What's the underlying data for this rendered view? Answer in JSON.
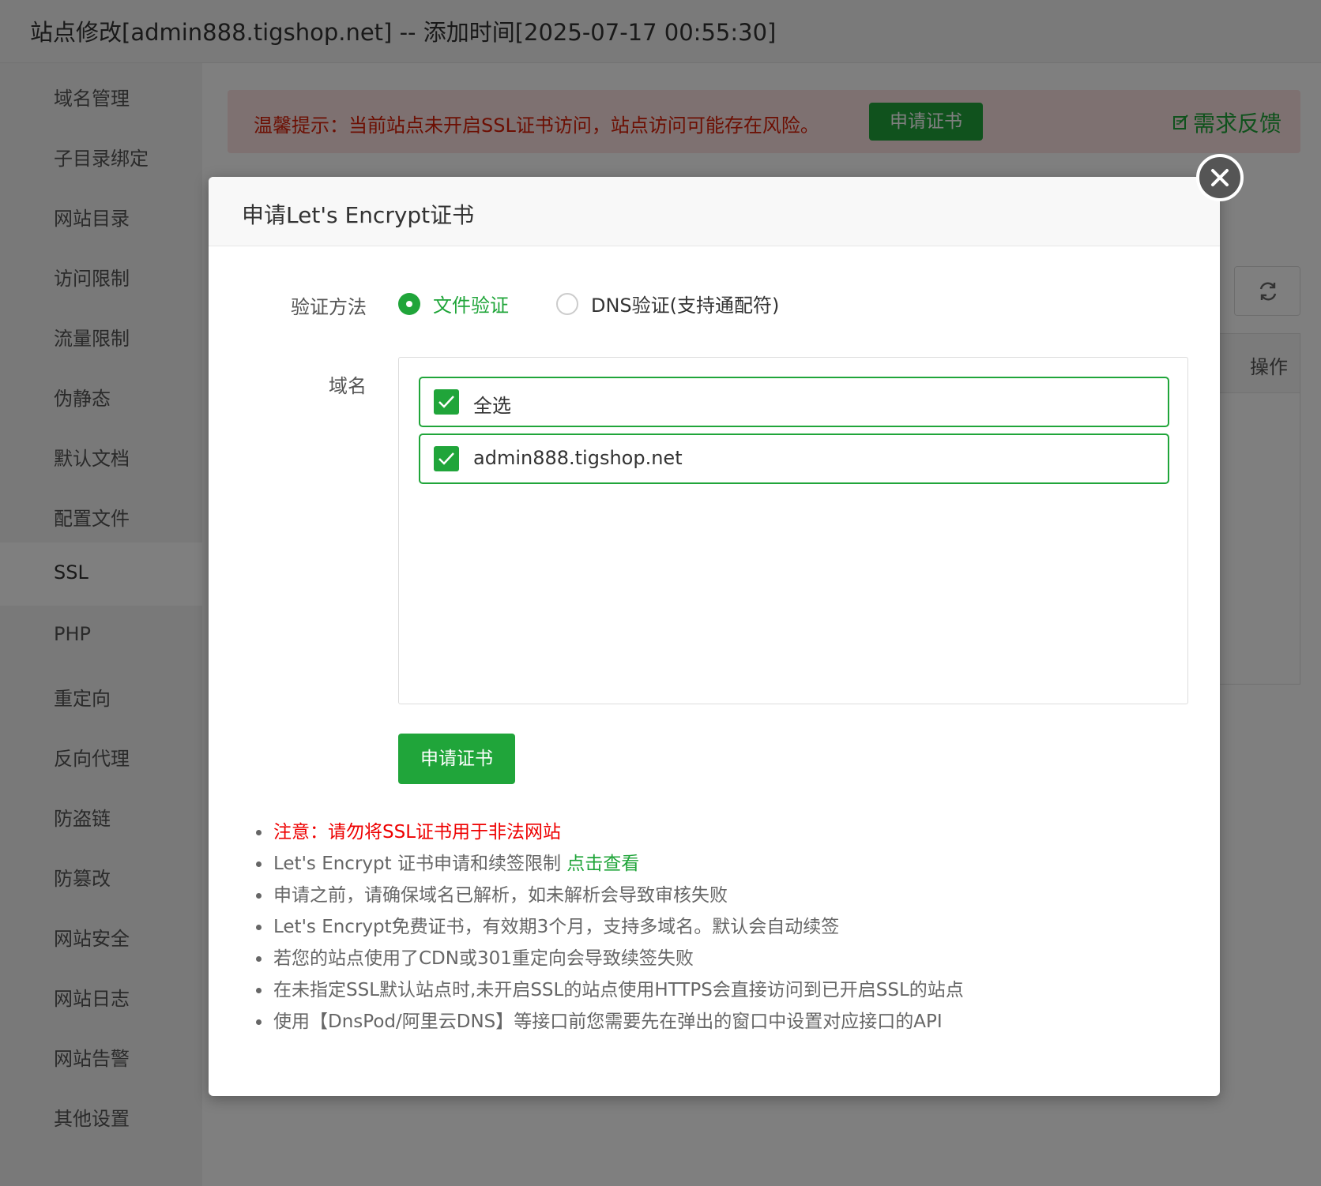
{
  "window": {
    "title": "站点修改[admin888.tigshop.net] -- 添加时间[2025-07-17 00:55:30]"
  },
  "sidebar": {
    "items": [
      {
        "label": "域名管理"
      },
      {
        "label": "子目录绑定"
      },
      {
        "label": "网站目录"
      },
      {
        "label": "访问限制"
      },
      {
        "label": "流量限制"
      },
      {
        "label": "伪静态"
      },
      {
        "label": "默认文档"
      },
      {
        "label": "配置文件"
      },
      {
        "label": "SSL",
        "active": true
      },
      {
        "label": "PHP"
      },
      {
        "label": "重定向"
      },
      {
        "label": "反向代理"
      },
      {
        "label": "防盗链"
      },
      {
        "label": "防篡改"
      },
      {
        "label": "网站安全"
      },
      {
        "label": "网站日志"
      },
      {
        "label": "网站告警"
      },
      {
        "label": "其他设置"
      }
    ]
  },
  "alert": {
    "text": "温馨提示：当前站点未开启SSL证书访问，站点访问可能存在风险。",
    "button_label": "申请证书",
    "feedback_label": "需求反馈",
    "feedback_icon": "edit-icon"
  },
  "table": {
    "action_header": "操作",
    "refresh_icon": "refresh-icon"
  },
  "modal": {
    "title": "申请Let's Encrypt证书",
    "close_icon": "close-icon",
    "verify_label": "验证方法",
    "verify_options": [
      {
        "label": "文件验证",
        "selected": true
      },
      {
        "label": "DNS验证(支持通配符)",
        "selected": false
      }
    ],
    "domain_label": "域名",
    "domains": [
      {
        "label": "全选",
        "checked": true
      },
      {
        "label": "admin888.tigshop.net",
        "checked": true
      }
    ],
    "apply_button": "申请证书",
    "notes": [
      {
        "text": "注意：请勿将SSL证书用于非法网站",
        "warn": true
      },
      {
        "text": "Let's Encrypt 证书申请和续签限制 ",
        "link": "点击查看"
      },
      {
        "text": "申请之前，请确保域名已解析，如未解析会导致审核失败"
      },
      {
        "text": "Let's Encrypt免费证书，有效期3个月，支持多域名。默认会自动续签"
      },
      {
        "text": "若您的站点使用了CDN或301重定向会导致续签失败"
      },
      {
        "text": "在未指定SSL默认站点时,未开启SSL的站点使用HTTPS会直接访问到已开启SSL的站点"
      },
      {
        "text": "使用【DnsPod/阿里云DNS】等接口前您需要先在弹出的窗口中设置对应接口的API"
      }
    ]
  },
  "colors": {
    "accent": "#20a53a",
    "warning": "#e00000",
    "alert_bg": "#fde2e2"
  }
}
